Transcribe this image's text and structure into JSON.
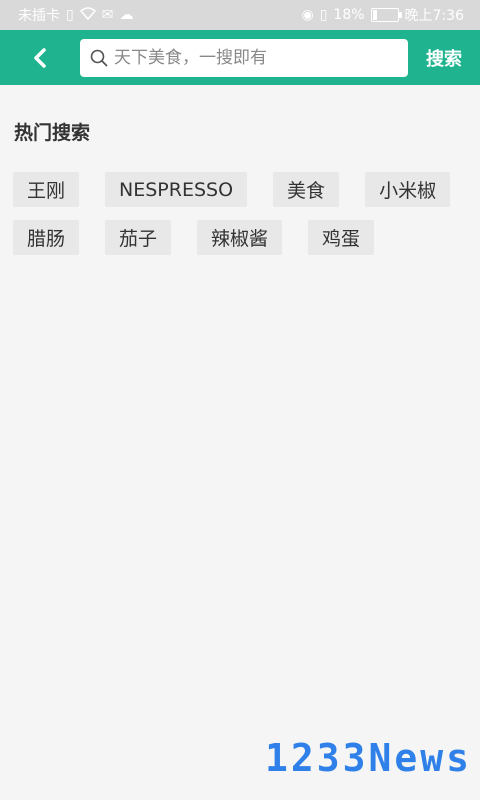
{
  "status_bar": {
    "carrier": "未插卡",
    "battery_percent": "18%",
    "battery_level": 0.18,
    "time": "晚上7:36",
    "icons": [
      "sim-icon",
      "wifi-icon",
      "message-icon",
      "cloud-icon",
      "eye-icon",
      "vibrate-icon",
      "battery-icon"
    ]
  },
  "toolbar": {
    "back_icon": "chevron-left-icon",
    "search_icon": "search-icon",
    "search_placeholder": "天下美食，一搜即有",
    "search_value": "",
    "search_button": "搜索",
    "background_color": "#1fb48f"
  },
  "hot_search": {
    "title": "热门搜索",
    "tags": [
      "王刚",
      "NESPRESSO",
      "美食",
      "小米椒",
      "腊肠",
      "茄子",
      "辣椒酱",
      "鸡蛋"
    ]
  },
  "watermark": {
    "text": "1233News",
    "color": "#2f80e8"
  }
}
